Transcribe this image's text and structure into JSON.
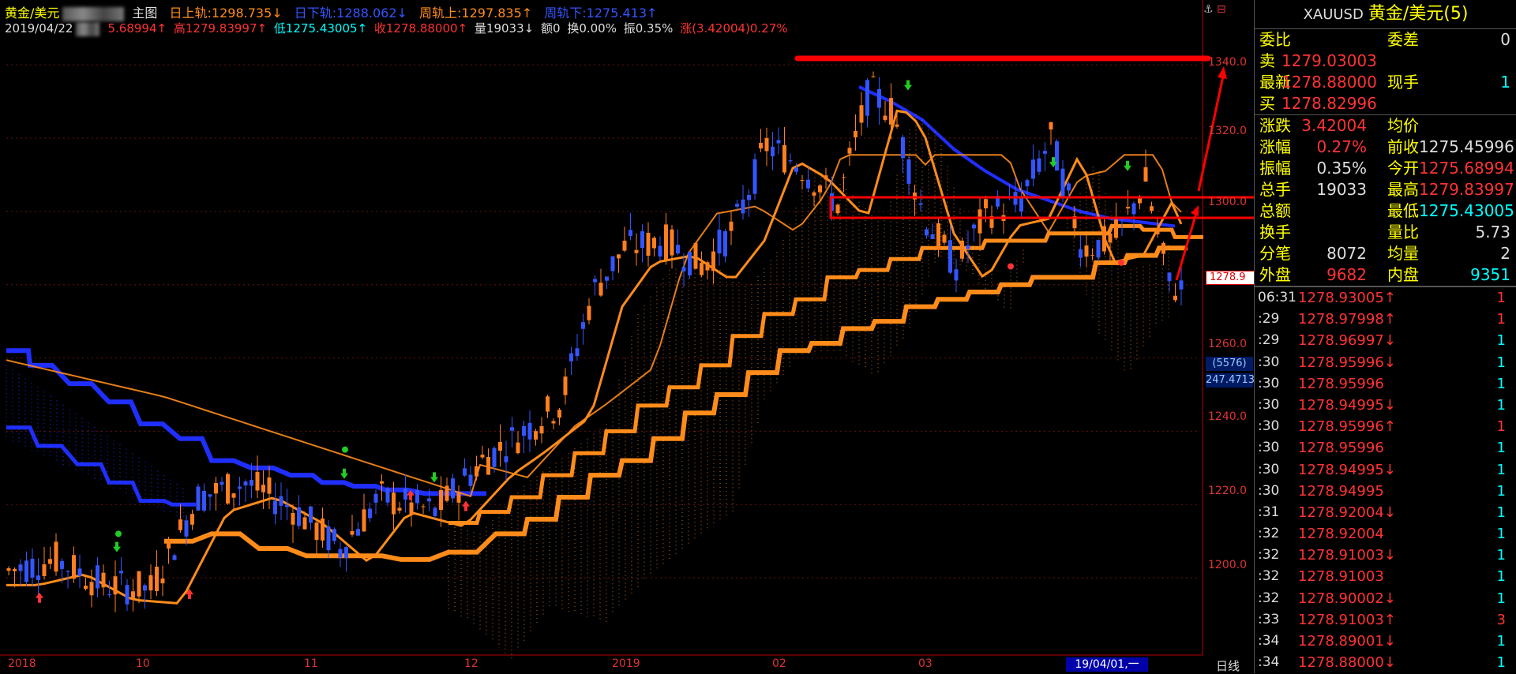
{
  "header": {
    "symbol": "黄金/美元",
    "chart_type": "主图",
    "day_upper": "日上轨:1298.735↓",
    "day_lower": "日下轨:1288.062↓",
    "week_upper": "周轨上:1297.835↑",
    "week_lower": "周轨下:1275.413↑",
    "date": "2019/04/22",
    "open": "5.68994↑",
    "high": "高1279.83997↑",
    "low": "低1275.43005↑",
    "close": "收1278.88000↑",
    "volume": "量19033↓",
    "amount": "额0",
    "turnover": "换0.00%",
    "amplitude": "振0.35%",
    "change": "涨(3.42004)0.27%"
  },
  "axis": {
    "y_labels": [
      "1340.0",
      "1320.0",
      "1300.0",
      "1280.0",
      "1260.0",
      "1240.0",
      "1220.0",
      "1200.0"
    ],
    "price_tag": "1278.9",
    "vol_tag": "(5576)",
    "vol_tag2": "247.4713",
    "x_labels": [
      "2018",
      "10",
      "11",
      "12",
      "2019",
      "02",
      "03"
    ],
    "cursor_date": "19/04/01,一",
    "period": "日线"
  },
  "colors": {
    "bull": "#ff7f1f",
    "bear": "#3355ff",
    "band_orange": "#ff8c1a",
    "band_blue": "#1f2fff",
    "annotation": "#ff0000"
  },
  "panel": {
    "symbol": "XAUUSD",
    "name": "黄金/美元(5)",
    "rows_top": [
      {
        "l": "委比",
        "v": "",
        "l2": "委差",
        "v2": "0"
      },
      {
        "l": "卖",
        "v": "1279.03003",
        "l2": "",
        "v2": ""
      },
      {
        "l": "最新",
        "v": "1278.88000",
        "l2": "现手",
        "v2": "1"
      },
      {
        "l": "买",
        "v": "1278.82996",
        "l2": "",
        "v2": ""
      }
    ],
    "rows_mid": [
      {
        "l": "涨跌",
        "v": "3.42004",
        "l2": "均价",
        "v2": "",
        "c": "up"
      },
      {
        "l": "涨幅",
        "v": "0.27%",
        "l2": "前收",
        "v2": "1275.45996",
        "c": "up"
      },
      {
        "l": "振幅",
        "v": "0.35%",
        "l2": "今开",
        "v2": "1275.68994",
        "c": "w"
      },
      {
        "l": "总手",
        "v": "19033",
        "l2": "最高",
        "v2": "1279.83997",
        "c": "w"
      },
      {
        "l": "总额",
        "v": "",
        "l2": "最低",
        "v2": "1275.43005",
        "c": "w"
      },
      {
        "l": "换手",
        "v": "",
        "l2": "量比",
        "v2": "5.73",
        "c": "w"
      },
      {
        "l": "分笔",
        "v": "8072",
        "l2": "均量",
        "v2": "2",
        "c": "w"
      },
      {
        "l": "外盘",
        "v": "9682",
        "l2": "内盘",
        "v2": "9351",
        "c": "w"
      }
    ],
    "ticks": [
      {
        "t": "06:31",
        "p": "1278.93005↑",
        "v": "1"
      },
      {
        "t": ":29",
        "p": "1278.97998↑",
        "v": "1"
      },
      {
        "t": ":29",
        "p": "1278.96997↓",
        "v": "1"
      },
      {
        "t": ":30",
        "p": "1278.95996↓",
        "v": "1"
      },
      {
        "t": ":30",
        "p": "1278.95996",
        "v": "1"
      },
      {
        "t": ":30",
        "p": "1278.94995↓",
        "v": "1"
      },
      {
        "t": ":30",
        "p": "1278.95996↑",
        "v": "1"
      },
      {
        "t": ":30",
        "p": "1278.95996",
        "v": "1"
      },
      {
        "t": ":30",
        "p": "1278.94995↓",
        "v": "1"
      },
      {
        "t": ":30",
        "p": "1278.94995",
        "v": "1"
      },
      {
        "t": ":31",
        "p": "1278.92004↓",
        "v": "1"
      },
      {
        "t": ":32",
        "p": "1278.92004",
        "v": "1"
      },
      {
        "t": ":32",
        "p": "1278.91003↓",
        "v": "1"
      },
      {
        "t": ":32",
        "p": "1278.91003",
        "v": "1"
      },
      {
        "t": ":32",
        "p": "1278.90002↓",
        "v": "1"
      },
      {
        "t": ":33",
        "p": "1278.91003↑",
        "v": "3"
      },
      {
        "t": ":34",
        "p": "1278.89001↓",
        "v": "1"
      },
      {
        "t": ":34",
        "p": "1278.88000↓",
        "v": "1"
      }
    ]
  }
}
